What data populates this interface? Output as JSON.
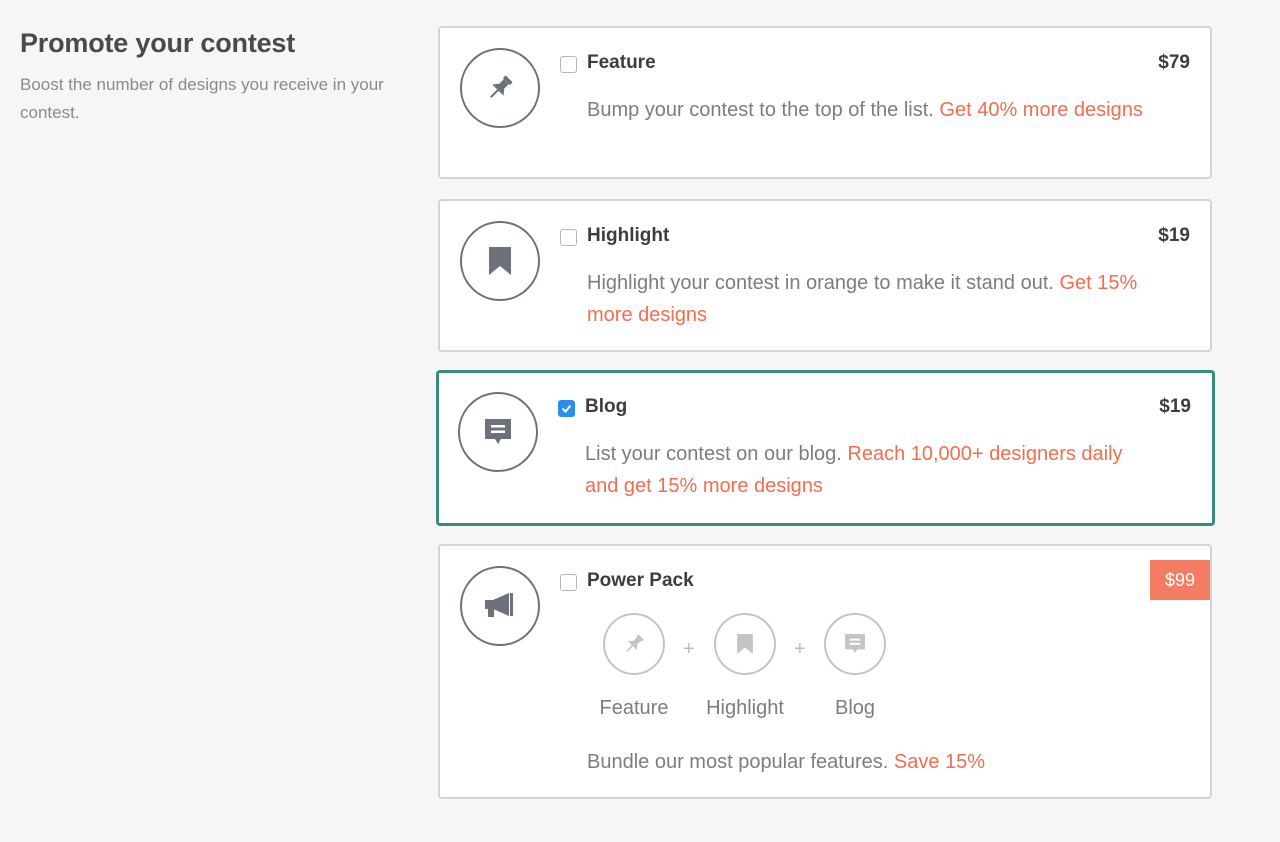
{
  "intro": {
    "title": "Promote your contest",
    "subtitle": "Boost the number of designs you receive in your contest."
  },
  "options": [
    {
      "name": "Feature",
      "price": "$79",
      "checked": false,
      "icon": "pin-icon",
      "desc_plain": "Bump your contest to the top of the list. ",
      "desc_accent": "Get 40% more designs"
    },
    {
      "name": "Highlight",
      "price": "$19",
      "checked": false,
      "icon": "bookmark-icon",
      "desc_plain": "Highlight your contest in orange to make it stand out. ",
      "desc_accent": "Get 15% more designs"
    },
    {
      "name": "Blog",
      "price": "$19",
      "checked": true,
      "icon": "blog-comment-icon",
      "desc_plain": "List your contest on our blog. ",
      "desc_accent": "Reach 10,000+ designers daily and get 15% more designs"
    }
  ],
  "power_pack": {
    "name": "Power Pack",
    "price": "$99",
    "checked": false,
    "icon": "megaphone-icon",
    "bundle": [
      {
        "label": "Feature",
        "icon": "pin-icon"
      },
      {
        "label": "Highlight",
        "icon": "bookmark-icon"
      },
      {
        "label": "Blog",
        "icon": "blog-comment-icon"
      }
    ],
    "plus": "+",
    "desc_plain": "Bundle our most popular features. ",
    "desc_accent": "Save 15%"
  },
  "colors": {
    "accent": "#f36d4f",
    "selected_border": "#3a8b7f",
    "checkbox_checked": "#2d8cf0",
    "badge": "#f47c63"
  }
}
